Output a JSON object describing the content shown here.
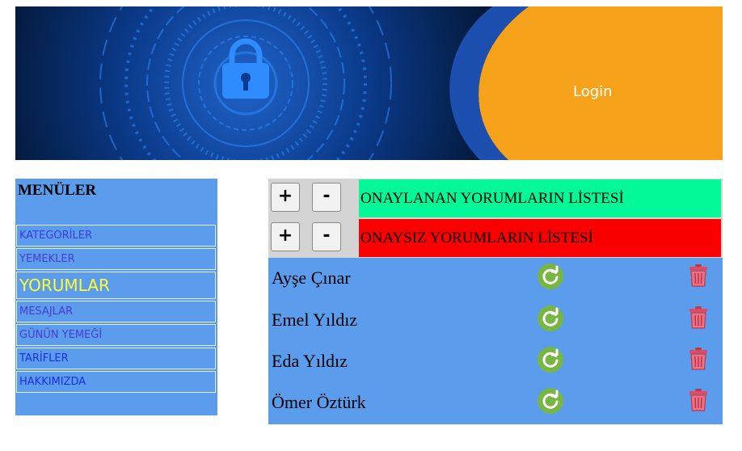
{
  "header": {
    "login_label": "Login"
  },
  "sidebar": {
    "title": "MENÜLER",
    "items": [
      {
        "label": "KATEGORİLER",
        "color": "#3b3be0"
      },
      {
        "label": "YEMEKLER",
        "color": "#4a3cd0"
      },
      {
        "label": "YORUMLAR",
        "color": "#ffff2e",
        "active": true
      },
      {
        "label": "MESAJLAR",
        "color": "#4a3cd0"
      },
      {
        "label": "GÜNÜN YEMEĞİ",
        "color": "#4a3cd0"
      },
      {
        "label": "TARİFLER",
        "color": "#1b2ee8"
      },
      {
        "label": "HAKKIMIZDA",
        "color": "#1b2ee8"
      }
    ]
  },
  "main": {
    "lists": [
      {
        "plus": "+",
        "minus": "-",
        "title": "ONAYLANAN YORUMLARIN LİSTESİ",
        "color": "#03f998"
      },
      {
        "plus": "+",
        "minus": "-",
        "title": "ONAYSIZ YORUMLARIN LİSTESİ",
        "color": "#fb0000"
      }
    ],
    "comments": [
      {
        "name": "Ayşe Çınar"
      },
      {
        "name": "Emel Yıldız"
      },
      {
        "name": "Eda Yıldız"
      },
      {
        "name": "Ömer Öztürk"
      }
    ],
    "icons": {
      "restore": "restore-icon",
      "delete": "trash-icon"
    }
  },
  "colors": {
    "panel_blue": "#5c9cec",
    "banner_orange": "#f7a21b",
    "banner_dark_blue": "#0a2a66",
    "restore_green": "#78b642",
    "trash_pink": "#e04a62"
  }
}
